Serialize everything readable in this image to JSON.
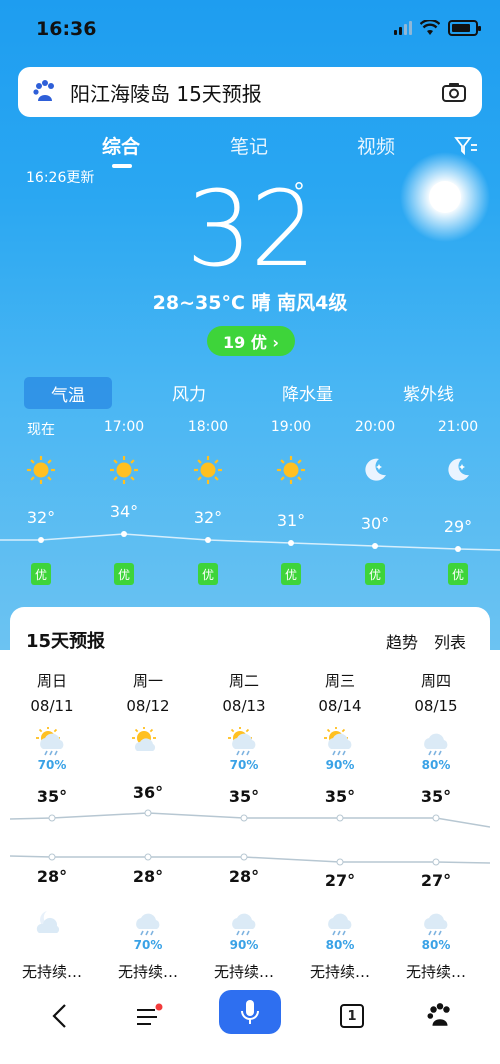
{
  "status": {
    "time": "16:36"
  },
  "search": {
    "query": "阳江海陵岛 15天预报"
  },
  "tabs": [
    "综合",
    "笔记",
    "视频"
  ],
  "updated": "16:26更新",
  "current": {
    "temp": "32",
    "degree": "°",
    "summary": "28~35°C 晴 南风4级",
    "aqi": "19 优 ›"
  },
  "metric_tabs": [
    "气温",
    "风力",
    "降水量",
    "紫外线"
  ],
  "hourly": [
    {
      "time": "现在",
      "temp": "32°",
      "icon": "sun-icon",
      "aq": "优"
    },
    {
      "time": "17:00",
      "temp": "34°",
      "icon": "sun-icon",
      "aq": "优"
    },
    {
      "time": "18:00",
      "temp": "32°",
      "icon": "sun-icon",
      "aq": "优"
    },
    {
      "time": "19:00",
      "temp": "31°",
      "icon": "sun-icon",
      "aq": "优"
    },
    {
      "time": "20:00",
      "temp": "30°",
      "icon": "moon-icon",
      "aq": "优"
    },
    {
      "time": "21:00",
      "temp": "29°",
      "icon": "moon-icon",
      "aq": "优"
    }
  ],
  "forecast": {
    "title": "15天预报",
    "options": [
      "趋势",
      "列表"
    ],
    "days": [
      {
        "day": "周日",
        "date": "08/11",
        "day_icon": "sun-rain-icon",
        "day_pct": "70%",
        "hi": "35°",
        "lo": "28°",
        "night_icon": "moon-cloud-icon",
        "night_pct": "",
        "wind": "无持续…"
      },
      {
        "day": "周一",
        "date": "08/12",
        "day_icon": "sun-cloud-icon",
        "day_pct": "",
        "hi": "36°",
        "lo": "28°",
        "night_icon": "cloud-rain-icon",
        "night_pct": "70%",
        "wind": "无持续…"
      },
      {
        "day": "周二",
        "date": "08/13",
        "day_icon": "sun-rain-icon",
        "day_pct": "70%",
        "hi": "35°",
        "lo": "28°",
        "night_icon": "cloud-rain-icon",
        "night_pct": "90%",
        "wind": "无持续…"
      },
      {
        "day": "周三",
        "date": "08/14",
        "day_icon": "sun-rain-icon",
        "day_pct": "90%",
        "hi": "35°",
        "lo": "27°",
        "night_icon": "cloud-rain-icon",
        "night_pct": "80%",
        "wind": "无持续…"
      },
      {
        "day": "周四",
        "date": "08/15",
        "day_icon": "cloud-rain-icon",
        "day_pct": "80%",
        "hi": "35°",
        "lo": "27°",
        "night_icon": "cloud-rain-icon",
        "night_pct": "80%",
        "wind": "无持续…"
      }
    ]
  },
  "nav": {
    "pages": "1"
  },
  "colors": {
    "sky": "#2aa7f2",
    "good": "#3ed43a",
    "accent": "#2e6ff0"
  }
}
